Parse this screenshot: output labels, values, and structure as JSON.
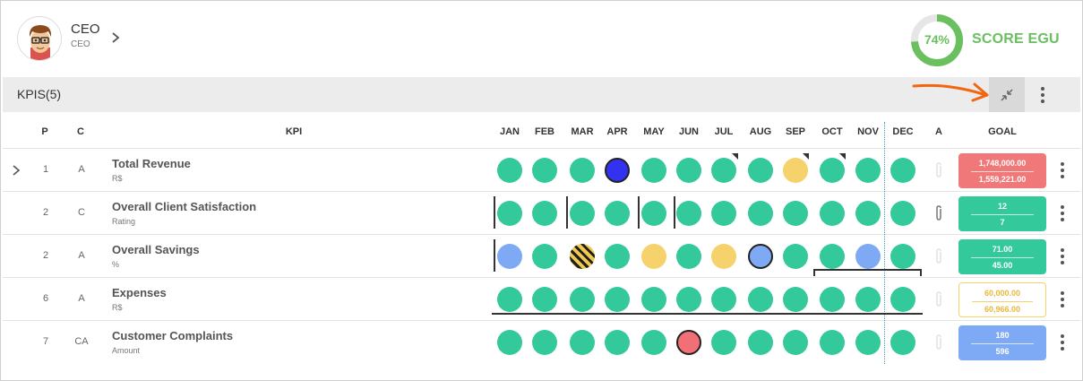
{
  "user": {
    "name": "CEO",
    "role": "CEO",
    "avatar_icon": "avatar-icon"
  },
  "score": {
    "percent": "74%",
    "value": 0.74,
    "label": "SCORE EGU",
    "color": "#6abf5e"
  },
  "kpi_section": {
    "title": "KPIS(5)"
  },
  "columns": {
    "p": "P",
    "c": "C",
    "kpi": "KPI",
    "months": [
      "JAN",
      "FEB",
      "MAR",
      "APR",
      "MAY",
      "JUN",
      "JUL",
      "AUG",
      "SEP",
      "OCT",
      "NOV",
      "DEC"
    ],
    "a": "A",
    "goal": "GOAL"
  },
  "rows": [
    {
      "p": "1",
      "c": "A",
      "name": "Total Revenue",
      "unit": "R$",
      "expandable": true,
      "months": [
        "green",
        "green",
        "green",
        "blue",
        "green",
        "green",
        "green",
        "green",
        "yellow",
        "green",
        "green",
        "green"
      ],
      "goal": {
        "target": "1,748,000.00",
        "actual": "1,559,221.00",
        "status": "red"
      },
      "attachment": false
    },
    {
      "p": "2",
      "c": "C",
      "name": "Overall Client Satisfaction",
      "unit": "Rating",
      "expandable": false,
      "months": [
        "green",
        "green",
        "green",
        "green",
        "green",
        "green",
        "green",
        "green",
        "green",
        "green",
        "green",
        "green"
      ],
      "goal": {
        "target": "12",
        "actual": "7",
        "status": "green"
      },
      "attachment": true
    },
    {
      "p": "2",
      "c": "A",
      "name": "Overall Savings",
      "unit": "%",
      "expandable": false,
      "months": [
        "lightblue",
        "green",
        "striped",
        "green",
        "yellow",
        "green",
        "yellow",
        "lightblue-b",
        "green",
        "green",
        "lightblue",
        "green"
      ],
      "goal": {
        "target": "71.00",
        "actual": "45.00",
        "status": "green"
      },
      "attachment": false
    },
    {
      "p": "6",
      "c": "A",
      "name": "Expenses",
      "unit": "R$",
      "expandable": false,
      "months": [
        "green",
        "green",
        "green",
        "green",
        "green",
        "green",
        "green",
        "green",
        "green",
        "green",
        "green",
        "green"
      ],
      "goal": {
        "target": "60,000.00",
        "actual": "60,966.00",
        "status": "outline-yellow"
      },
      "attachment": false
    },
    {
      "p": "7",
      "c": "CA",
      "name": "Customer Complaints",
      "unit": "Amount",
      "expandable": false,
      "months": [
        "green",
        "green",
        "green",
        "green",
        "green",
        "red-b",
        "green",
        "green",
        "green",
        "green",
        "green",
        "green"
      ],
      "goal": {
        "target": "180",
        "actual": "596",
        "status": "blue"
      },
      "attachment": false
    }
  ],
  "colors": {
    "green": "#34c99b",
    "red": "#f07878",
    "yellow": "#f5d26c",
    "blue": "#7eaaf5",
    "dark_blue": "#3232f0"
  }
}
